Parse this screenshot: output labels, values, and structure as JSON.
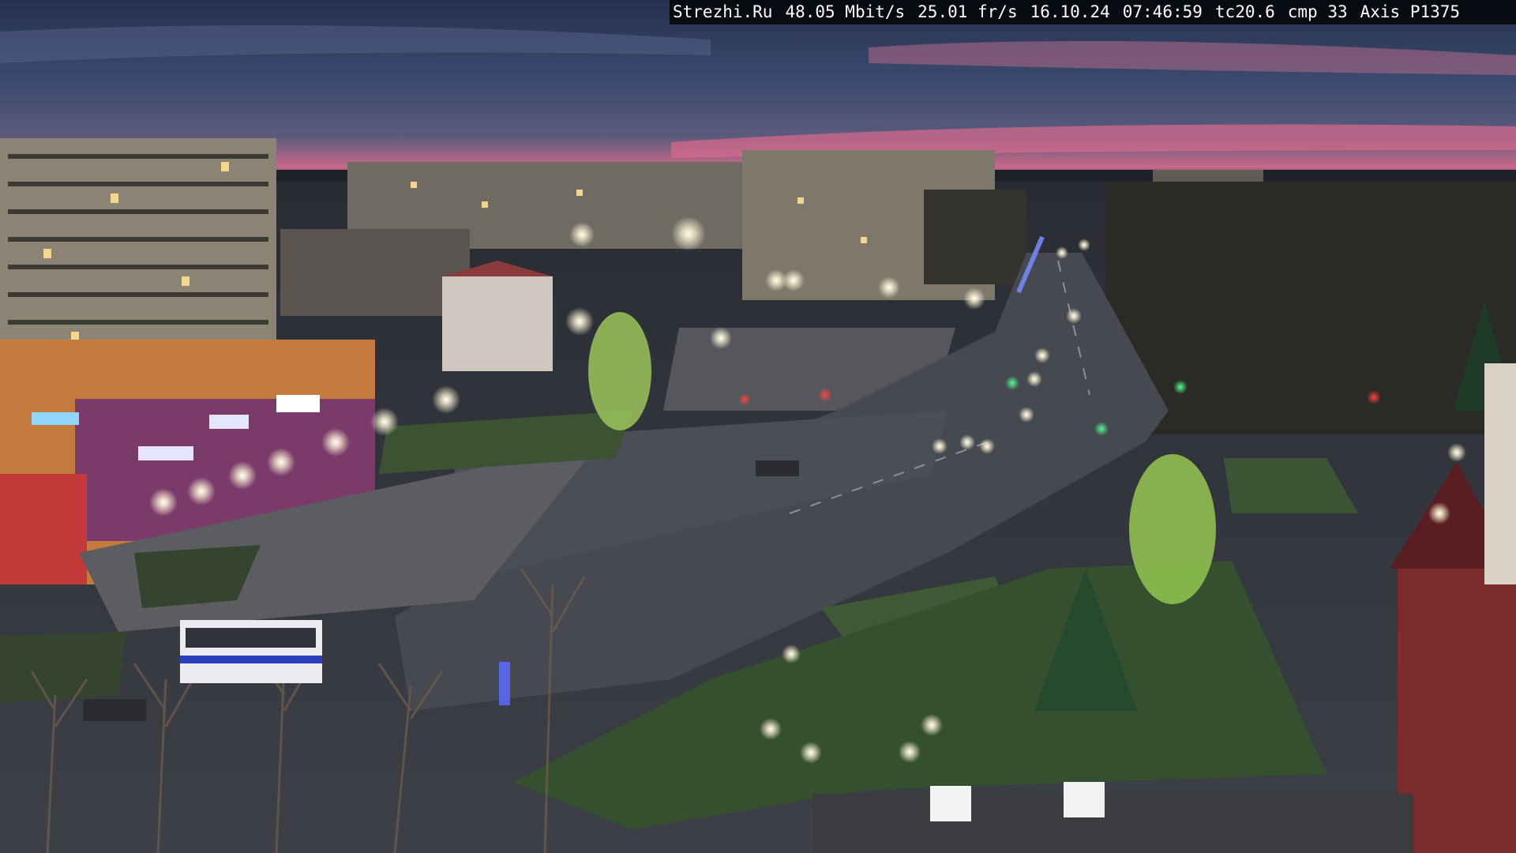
{
  "overlay": {
    "site": "Strezhi.Ru",
    "bitrate": "48.05 Mbit/s",
    "framerate": "25.01 fr/s",
    "date": "16.10.24",
    "time": "07:46:59",
    "tc": "tc20.6",
    "cmp": "cmp 33",
    "camera": "Axis P1375"
  },
  "scene": {
    "description_tags": [
      "dusk",
      "city-street",
      "webcam"
    ],
    "colors": {
      "sky_top": "#2c3656",
      "sky_mid": "#47557a",
      "sky_glow": "#d56a8a",
      "ground": "#3a3e45",
      "road": "#45484f",
      "grass": "#2f4a2c",
      "light_glow": "#fff7d6"
    }
  }
}
